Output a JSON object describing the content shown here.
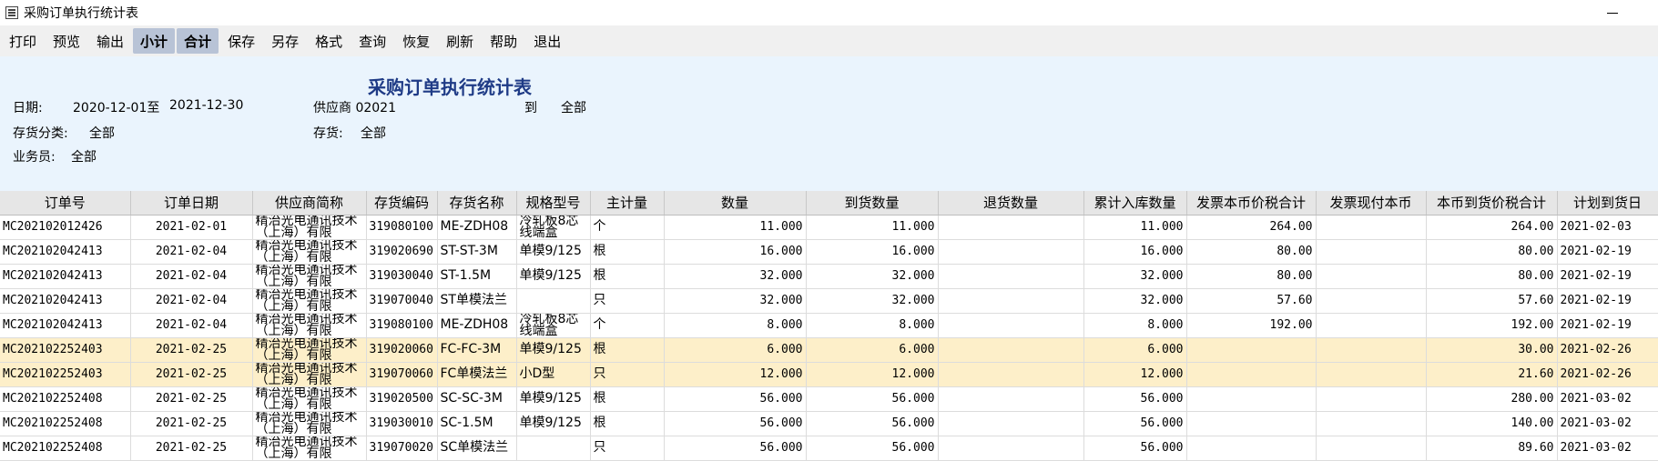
{
  "window": {
    "title": "采购订单执行统计表"
  },
  "toolbar": {
    "buttons": [
      {
        "label": "打印",
        "active": false
      },
      {
        "label": "预览",
        "active": false
      },
      {
        "label": "输出",
        "active": false
      },
      {
        "label": "小计",
        "active": true
      },
      {
        "label": "合计",
        "active": true
      },
      {
        "label": "保存",
        "active": false
      },
      {
        "label": "另存",
        "active": false
      },
      {
        "label": "格式",
        "active": false
      },
      {
        "label": "查询",
        "active": false
      },
      {
        "label": "恢复",
        "active": false
      },
      {
        "label": "刷新",
        "active": false
      },
      {
        "label": "帮助",
        "active": false
      },
      {
        "label": "退出",
        "active": false
      }
    ]
  },
  "report": {
    "title": "采购订单执行统计表",
    "date_label": "日期:",
    "date_from": "2020-12-01至",
    "date_to": "2021-12-30",
    "supplier_label": "供应商 02021",
    "to_label": "到",
    "to_value": "全部",
    "category_label": "存货分类:",
    "category_value": "全部",
    "inventory_label": "存货:",
    "inventory_value": "全部",
    "salesman_label": "业务员:",
    "salesman_value": "全部"
  },
  "table": {
    "columns": [
      "订单号",
      "订单日期",
      "供应商简称",
      "存货编码",
      "存货名称",
      "规格型号",
      "主计量",
      "数量",
      "到货数量",
      "退货数量",
      "累计入库数量",
      "发票本币价税合计",
      "发票现付本币",
      "本币到货价税合计",
      "计划到货日"
    ],
    "rows": [
      {
        "cells": [
          "MC202102012426",
          "2021-02-01",
          "精治光电通讯技术（上海）有限",
          "319080100",
          "ME-ZDH08",
          "冷轧板8芯线端盒",
          "个",
          "11.000",
          "11.000",
          "",
          "11.000",
          "264.00",
          "",
          "264.00",
          "2021-02-03"
        ],
        "highlight": false
      },
      {
        "cells": [
          "MC202102042413",
          "2021-02-04",
          "精治光电通讯技术（上海）有限",
          "319020690",
          "ST-ST-3M",
          "单模9/125",
          "根",
          "16.000",
          "16.000",
          "",
          "16.000",
          "80.00",
          "",
          "80.00",
          "2021-02-19"
        ],
        "highlight": false
      },
      {
        "cells": [
          "MC202102042413",
          "2021-02-04",
          "精治光电通讯技术（上海）有限",
          "319030040",
          "ST-1.5M",
          "单模9/125",
          "根",
          "32.000",
          "32.000",
          "",
          "32.000",
          "80.00",
          "",
          "80.00",
          "2021-02-19"
        ],
        "highlight": false
      },
      {
        "cells": [
          "MC202102042413",
          "2021-02-04",
          "精治光电通讯技术（上海）有限",
          "319070040",
          "ST单模法兰",
          "",
          "只",
          "32.000",
          "32.000",
          "",
          "32.000",
          "57.60",
          "",
          "57.60",
          "2021-02-19"
        ],
        "highlight": false
      },
      {
        "cells": [
          "MC202102042413",
          "2021-02-04",
          "精治光电通讯技术（上海）有限",
          "319080100",
          "ME-ZDH08",
          "冷轧板8芯线端盒",
          "个",
          "8.000",
          "8.000",
          "",
          "8.000",
          "192.00",
          "",
          "192.00",
          "2021-02-19"
        ],
        "highlight": false
      },
      {
        "cells": [
          "MC202102252403",
          "2021-02-25",
          "精治光电通讯技术（上海）有限",
          "319020060",
          "FC-FC-3M",
          "单模9/125",
          "根",
          "6.000",
          "6.000",
          "",
          "6.000",
          "",
          "",
          "30.00",
          "2021-02-26"
        ],
        "highlight": true
      },
      {
        "cells": [
          "MC202102252403",
          "2021-02-25",
          "精治光电通讯技术（上海）有限",
          "319070060",
          "FC单模法兰",
          "小D型",
          "只",
          "12.000",
          "12.000",
          "",
          "12.000",
          "",
          "",
          "21.60",
          "2021-02-26"
        ],
        "highlight": true
      },
      {
        "cells": [
          "MC202102252408",
          "2021-02-25",
          "精治光电通讯技术（上海）有限",
          "319020500",
          "SC-SC-3M",
          "单模9/125",
          "根",
          "56.000",
          "56.000",
          "",
          "56.000",
          "",
          "",
          "280.00",
          "2021-03-02"
        ],
        "highlight": false
      },
      {
        "cells": [
          "MC202102252408",
          "2021-02-25",
          "精治光电通讯技术（上海）有限",
          "319030010",
          "SC-1.5M",
          "单模9/125",
          "根",
          "56.000",
          "56.000",
          "",
          "56.000",
          "",
          "",
          "140.00",
          "2021-03-02"
        ],
        "highlight": false
      },
      {
        "cells": [
          "MC202102252408",
          "2021-02-25",
          "精治光电通讯技术（上海）有限",
          "319070020",
          "SC单模法兰",
          "",
          "只",
          "56.000",
          "56.000",
          "",
          "56.000",
          "",
          "",
          "89.60",
          "2021-03-02"
        ],
        "highlight": false
      }
    ]
  }
}
